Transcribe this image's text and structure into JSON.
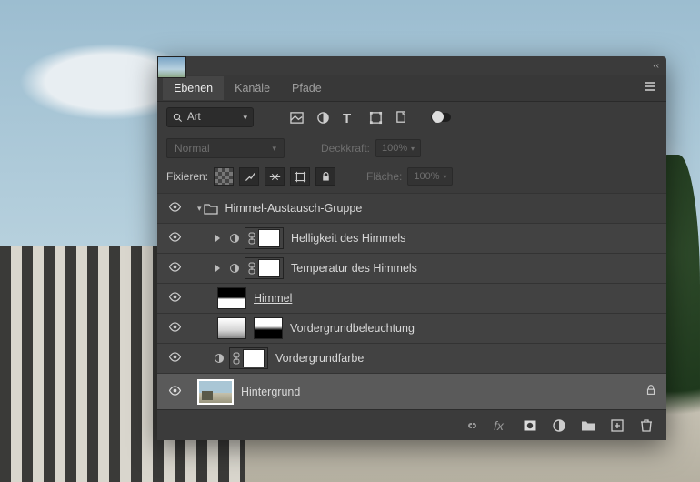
{
  "tabs": {
    "layers": "Ebenen",
    "channels": "Kanäle",
    "paths": "Pfade"
  },
  "search": {
    "label": "Art"
  },
  "filter_icons": [
    "image-icon",
    "adjustment-icon",
    "type-icon",
    "shape-icon",
    "smartobject-icon"
  ],
  "blend": {
    "mode": "Normal",
    "opacity_label": "Deckkraft:",
    "opacity_value": "100%"
  },
  "lock": {
    "label": "Fixieren:",
    "fill_label": "Fläche:",
    "fill_value": "100%"
  },
  "layers": [
    {
      "kind": "group",
      "name": "Himmel-Austausch-Gruppe"
    },
    {
      "kind": "adjustment",
      "name": "Helligkeit des Himmels",
      "clipped": true,
      "mask": "white"
    },
    {
      "kind": "adjustment",
      "name": "Temperatur des Himmels",
      "clipped": true,
      "mask": "white"
    },
    {
      "kind": "image",
      "name": "Himmel",
      "thumb": "sky",
      "mask": "mask-horizon",
      "underline": true
    },
    {
      "kind": "image",
      "name": "Vordergrundbeleuchtung",
      "thumb": "grad",
      "mask": "mask-inv-horizon"
    },
    {
      "kind": "adjustment",
      "name": "Vordergrundfarbe",
      "mask": "white"
    },
    {
      "kind": "background",
      "name": "Hintergrund",
      "locked": true
    }
  ],
  "footer_icons": [
    "link-icon",
    "fx-icon",
    "mask-icon",
    "adjustment-icon",
    "group-icon",
    "new-icon",
    "trash-icon"
  ]
}
